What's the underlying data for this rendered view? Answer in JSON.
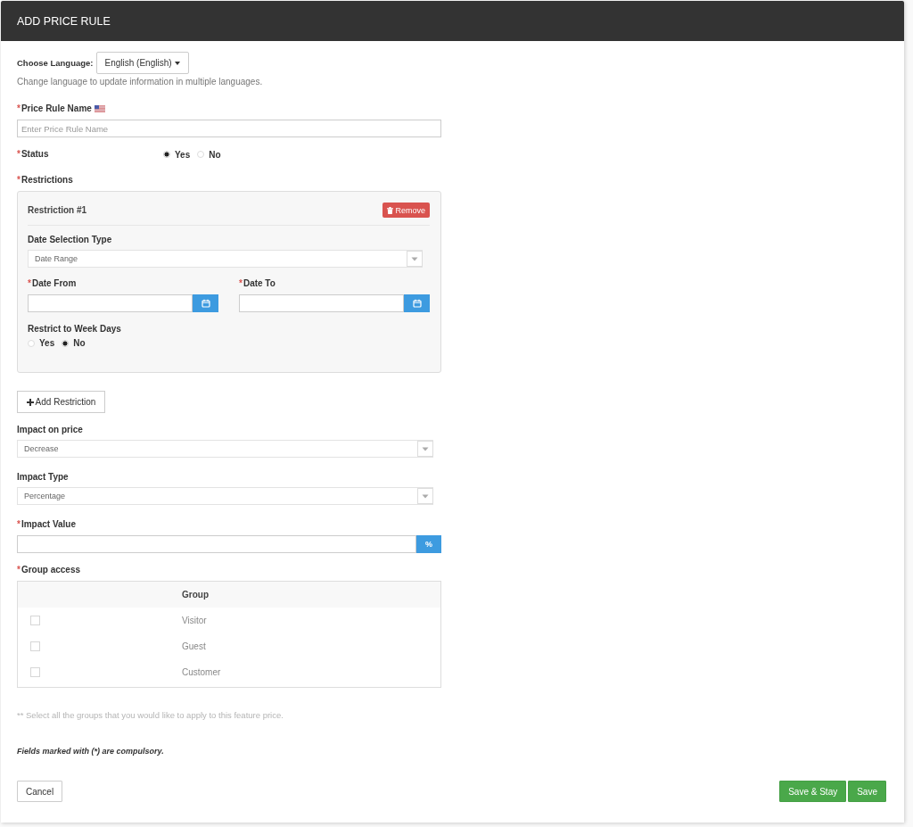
{
  "header": {
    "title": "ADD PRICE RULE"
  },
  "language": {
    "label": "Choose Language:",
    "value": "English (English)",
    "hint": "Change language to update information in multiple languages."
  },
  "price_rule_name": {
    "required_mark": "*",
    "label": "Price Rule Name",
    "placeholder": "Enter Price Rule Name"
  },
  "status": {
    "required_mark": "*",
    "label": "Status",
    "options": [
      {
        "label": "Yes",
        "selected": true
      },
      {
        "label": "No",
        "selected": false
      }
    ]
  },
  "restrictions": {
    "required_mark": "*",
    "label": "Restrictions",
    "items": [
      {
        "title": "Restriction #1",
        "remove_button": "Remove",
        "date_selection_type": {
          "label": "Date Selection Type",
          "value": "Date Range"
        },
        "date_from": {
          "required_mark": "*",
          "label": "Date From"
        },
        "date_to": {
          "required_mark": "*",
          "label": "Date To"
        },
        "week_days": {
          "label": "Restrict to Week Days",
          "options": [
            {
              "label": "Yes",
              "selected": false
            },
            {
              "label": "No",
              "selected": true
            }
          ]
        }
      }
    ],
    "add_button": "Add Restriction"
  },
  "impact_on_price": {
    "label": "Impact on price",
    "value": "Decrease"
  },
  "impact_type": {
    "label": "Impact Type",
    "value": "Percentage"
  },
  "impact_value": {
    "required_mark": "*",
    "label": "Impact Value",
    "addon": "%"
  },
  "group_access": {
    "required_mark": "*",
    "label": "Group access",
    "column_header": "Group",
    "rows": [
      {
        "name": "Visitor",
        "checked": false
      },
      {
        "name": "Guest",
        "checked": false
      },
      {
        "name": "Customer",
        "checked": false
      }
    ],
    "note": "** Select all the groups that you would like to apply to this feature price."
  },
  "footnote": "Fields marked with (*) are compulsory.",
  "buttons": [
    {
      "label": "Cancel",
      "kind": "default"
    },
    {
      "label": "Save & Stay",
      "kind": "success"
    },
    {
      "label": "Save",
      "kind": "success"
    }
  ]
}
